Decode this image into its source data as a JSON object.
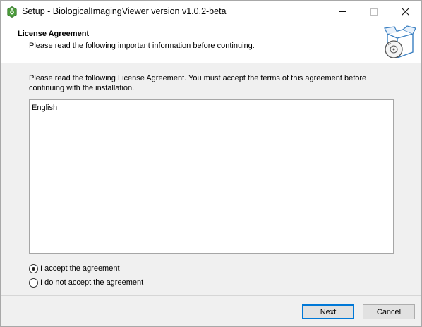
{
  "window": {
    "title": "Setup - BiologicalImagingViewer version v1.0.2-beta",
    "app_icon": "setup-app-icon",
    "controls": [
      "minimize-icon",
      "maximize-icon",
      "close-icon"
    ]
  },
  "header": {
    "title": "License Agreement",
    "subtitle": "Please read the following important information before continuing.",
    "graphic": "installer-box-disc-icon"
  },
  "main": {
    "instructions": "Please read the following License Agreement. You must accept the terms of this agreement before continuing with the installation.",
    "license_text": "English"
  },
  "options": {
    "accept_label": "I accept the agreement",
    "decline_label": "I do not accept the agreement",
    "selected": "accept"
  },
  "buttons": {
    "next_label": "Next",
    "cancel_label": "Cancel"
  },
  "colors": {
    "accent": "#0078d7",
    "window_bg": "#f0f0f0"
  }
}
